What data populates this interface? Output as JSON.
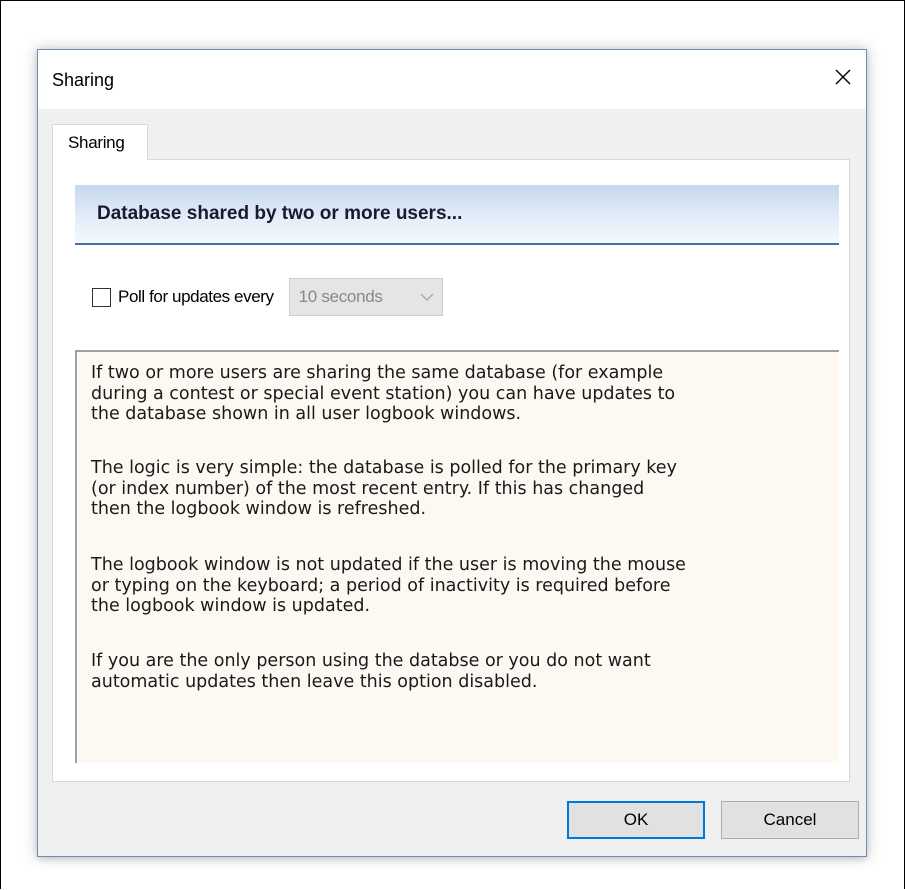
{
  "dialog": {
    "title": "Sharing",
    "close_icon": "close-icon"
  },
  "tabs": [
    {
      "label": "Sharing",
      "selected": true
    }
  ],
  "banner": {
    "text": "Database shared by two or more users..."
  },
  "poll": {
    "checkbox_checked": false,
    "label": "Poll for updates every",
    "interval_value": "10 seconds",
    "interval_enabled": false
  },
  "info": {
    "paragraphs": [
      "If two or more users are sharing the same database (for example\nduring a contest or special event station) you can have updates to\nthe database shown in all user logbook windows.",
      "The logic is very simple: the database is polled for the primary key\n(or index number) of the most recent entry. If this has changed\nthen the logbook window is refreshed.",
      "The logbook window is not updated if the user is moving the mouse\nor typing on the keyboard; a period of inactivity is required before\nthe logbook window is updated.",
      "If you are the only person using the databse or you do not want\nautomatic updates then leave this option disabled."
    ]
  },
  "buttons": {
    "ok_label": "OK",
    "cancel_label": "Cancel"
  },
  "colors": {
    "dialog_border": "#6f8db3",
    "banner_underline": "#4a6fa5",
    "info_background": "#fdf9f2",
    "default_button_border": "#0078d7"
  }
}
